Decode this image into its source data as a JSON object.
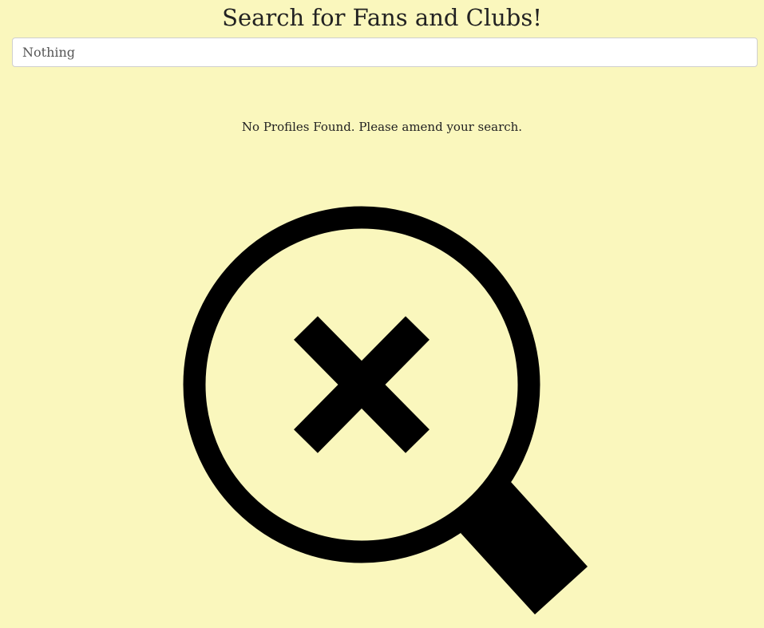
{
  "header": {
    "title": "Search for Fans and Clubs!"
  },
  "search": {
    "value": "Nothing",
    "placeholder": ""
  },
  "results": {
    "empty_message": "No Profiles Found. Please amend your search.",
    "icon": "search-no-results-icon"
  },
  "colors": {
    "background": "#faf7bd",
    "icon": "#000000",
    "text": "#222222"
  }
}
